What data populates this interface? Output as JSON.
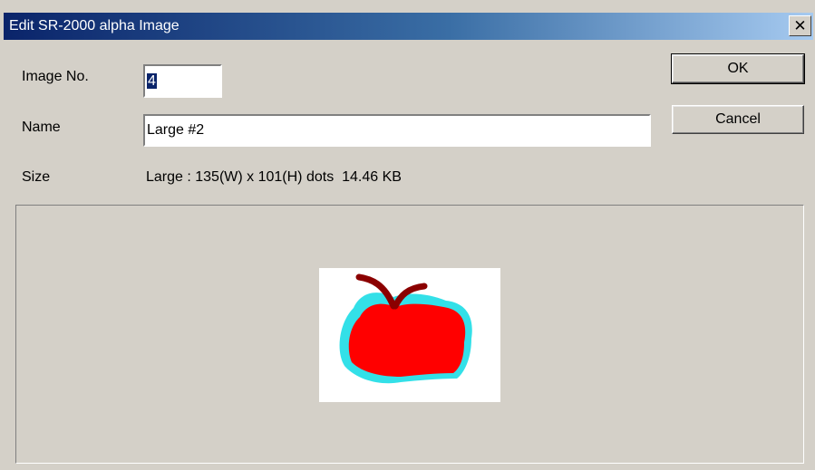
{
  "window": {
    "title": "Edit SR-2000 alpha Image",
    "close_glyph": "✕"
  },
  "form": {
    "image_no_label": "Image No.",
    "image_no_value": "4",
    "name_label": "Name",
    "name_value": "Large #2",
    "size_label": "Size",
    "size_value": "Large : 135(W) x 101(H) dots  14.46 KB"
  },
  "buttons": {
    "ok": "OK",
    "cancel": "Cancel"
  },
  "preview": {
    "description_icon": "apple-image",
    "colors": {
      "fill": "#ff0000",
      "outline": "#33e0e8",
      "stem": "#8b0000"
    }
  }
}
